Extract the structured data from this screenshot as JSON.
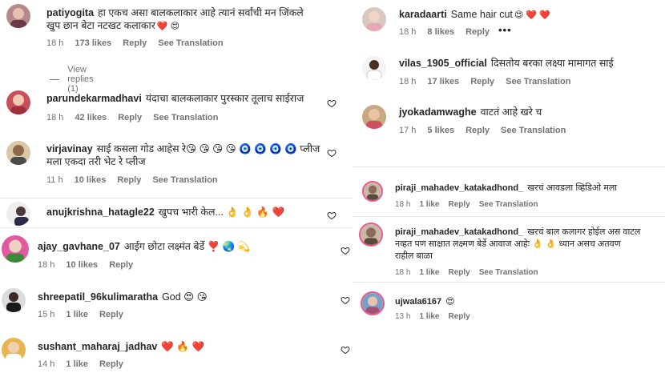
{
  "left": {
    "comments": [
      {
        "username": "patiyogita",
        "text1": "हा एकच असा बालकलाकार आहे त्यानं सर्वांची मन जिंकले",
        "text2": "खुप छान बेटा नटखट कलाकार",
        "emoji2": "❤️ 😍",
        "time": "18 h",
        "likes": "173 likes",
        "reply": "Reply",
        "translation": "See Translation",
        "view_replies": "View replies (1)"
      },
      {
        "username": "parundekarmadhavi",
        "text1": "यंदाचा बालकलाकार पुरस्कार तूलाच साईराज",
        "time": "18 h",
        "likes": "42 likes",
        "reply": "Reply",
        "translation": "See Translation"
      },
      {
        "username": "virjavinay",
        "text1": "साई कसला गोड आहेस रे😘 😘 😘 😘 🧿 🧿 🧿 🧿 प्लीज",
        "text2": "मला एकदा तरी भेट रे प्लीज",
        "time": "11 h",
        "likes": "10 likes",
        "reply": "Reply",
        "translation": "See Translation"
      },
      {
        "username": "anujkrishna_hatagle22",
        "text1": "खुपच भारी केल... 👌 👌 🔥 ❤️"
      },
      {
        "username": "ajay_gavhane_07",
        "text1": "आईग छोटा लक्ष्मंत बेर्डे ❣️ 🌏 💫",
        "time": "18 h",
        "likes": "10 likes",
        "reply": "Reply"
      },
      {
        "username": "shreepatil_96kulimaratha",
        "text1": "God 😍 😘",
        "time": "15 h",
        "likes": "1 like",
        "reply": "Reply"
      },
      {
        "username": "sushant_maharaj_jadhav",
        "text1": "❤️ 🔥 ❤️",
        "time": "14 h",
        "likes": "1 like",
        "reply": "Reply"
      }
    ]
  },
  "right": {
    "comments": [
      {
        "username": "karadaarti",
        "text1": "Same hair cut",
        "emoji1": "😍 ❤️ ❤️",
        "time": "18 h",
        "likes": "8 likes",
        "reply": "Reply",
        "more": "•••"
      },
      {
        "username": "vilas_1905_official",
        "text1": "दिसतोय बरका लक्ष्या मामागत साई",
        "time": "18 h",
        "likes": "17 likes",
        "reply": "Reply",
        "translation": "See Translation"
      },
      {
        "username": "jyokadamwaghe",
        "text1": "वाटतं आहे खरे च",
        "time": "17 h",
        "likes": "5 likes",
        "reply": "Reply",
        "translation": "See Translation"
      },
      {
        "username": "piraji_mahadev_katakadhond_",
        "text1": "खरचं आवडला व्हिडिओ मला",
        "time": "18 h",
        "likes": "1 like",
        "reply": "Reply",
        "translation": "See Translation"
      },
      {
        "username": "piraji_mahadev_katakadhond_",
        "text1": "खरचं बाल कलागर होईल अस वाटल",
        "text2": "नव्हत पण साक्षात लक्ष्मण बेर्डे आवाज आहेः 👌 👌 ध्यान असच अतवण",
        "text3": "राहील बाळा",
        "time": "18 h",
        "likes": "1 like",
        "reply": "Reply",
        "translation": "See Translation"
      },
      {
        "username": "ujwala6167",
        "text1": "😍",
        "time": "13 h",
        "likes": "1 like",
        "reply": "Reply"
      }
    ]
  },
  "colors": {
    "text": "#262626",
    "meta": "#737373",
    "separator": "#e6e6e6"
  }
}
